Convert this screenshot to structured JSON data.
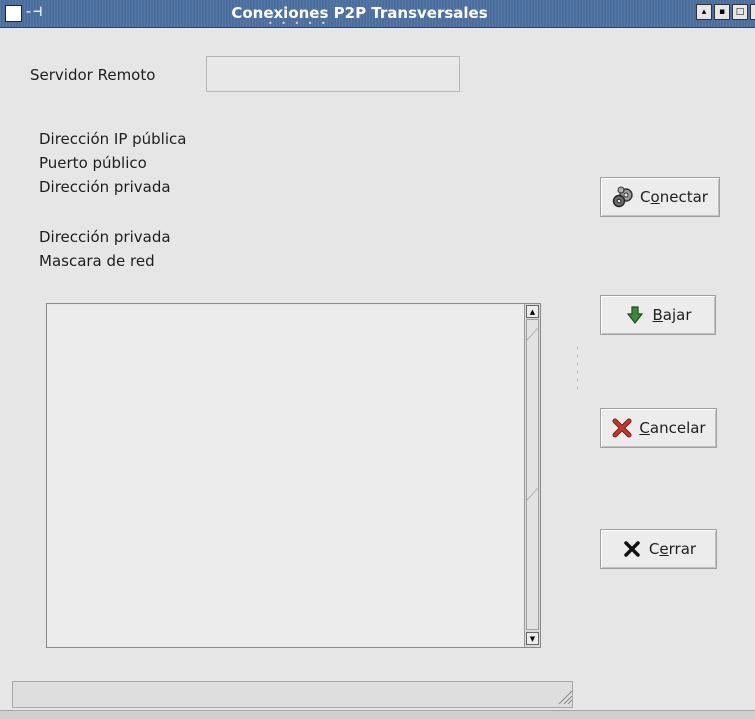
{
  "window": {
    "title": "Conexiones P2P Transversales",
    "pin_glyph": "-⊣",
    "controls": [
      {
        "name": "minimize",
        "glyph": "▴"
      },
      {
        "name": "maximize",
        "glyph": "▪"
      },
      {
        "name": "restore",
        "glyph": "□"
      },
      {
        "name": "close",
        "glyph": "✕"
      }
    ]
  },
  "form": {
    "remote_server_label": "Servidor Remoto",
    "remote_server_value": "",
    "info_labels": {
      "public_ip": "Dirección IP pública",
      "public_port": "Puerto público",
      "private_address_1": "Dirección privada",
      "private_address_2": "Dirección privada",
      "netmask": "Mascara de red"
    }
  },
  "buttons": {
    "connect": {
      "pre": "C",
      "mnemonic": "o",
      "post": "nectar",
      "icon": "gears-icon"
    },
    "download": {
      "pre": "",
      "mnemonic": "B",
      "post": "ajar",
      "icon": "arrow-down-icon"
    },
    "cancel": {
      "pre": "",
      "mnemonic": "C",
      "post": "ancelar",
      "icon": "red-x-icon"
    },
    "close": {
      "pre": "C",
      "mnemonic": "e",
      "post": "rrar",
      "icon": "black-x-icon"
    }
  },
  "log": {
    "text": ""
  },
  "status": {
    "text": ""
  },
  "colors": {
    "titlebar": "#4a6e9e",
    "background": "#e6e6e6",
    "cancel_icon": "#c0392b",
    "download_icon": "#3a8a3a"
  }
}
